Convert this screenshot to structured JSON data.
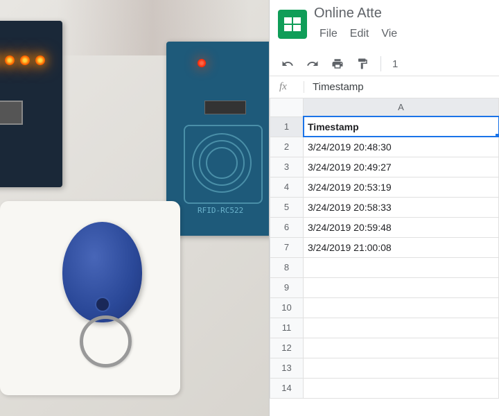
{
  "hardware": {
    "rfid_board_label": "RFID-RC522"
  },
  "sheets": {
    "doc_title": "Online Atte",
    "menu": {
      "file": "File",
      "edit": "Edit",
      "view": "Vie"
    },
    "toolbar": {
      "undo_icon": "undo",
      "redo_icon": "redo",
      "print_icon": "print",
      "paint_icon": "paint-format",
      "zoom_fragment": "1"
    },
    "fx": {
      "label": "fx",
      "value": "Timestamp"
    },
    "columns": [
      "A"
    ],
    "selected_cell": "A1",
    "rows": [
      {
        "num": 1,
        "cells": [
          "Timestamp"
        ]
      },
      {
        "num": 2,
        "cells": [
          "3/24/2019 20:48:30"
        ]
      },
      {
        "num": 3,
        "cells": [
          "3/24/2019 20:49:27"
        ]
      },
      {
        "num": 4,
        "cells": [
          "3/24/2019 20:53:19"
        ]
      },
      {
        "num": 5,
        "cells": [
          "3/24/2019 20:58:33"
        ]
      },
      {
        "num": 6,
        "cells": [
          "3/24/2019 20:59:48"
        ]
      },
      {
        "num": 7,
        "cells": [
          "3/24/2019 21:00:08"
        ]
      },
      {
        "num": 8,
        "cells": [
          ""
        ]
      },
      {
        "num": 9,
        "cells": [
          ""
        ]
      },
      {
        "num": 10,
        "cells": [
          ""
        ]
      },
      {
        "num": 11,
        "cells": [
          ""
        ]
      },
      {
        "num": 12,
        "cells": [
          ""
        ]
      },
      {
        "num": 13,
        "cells": [
          ""
        ]
      },
      {
        "num": 14,
        "cells": [
          ""
        ]
      }
    ]
  }
}
